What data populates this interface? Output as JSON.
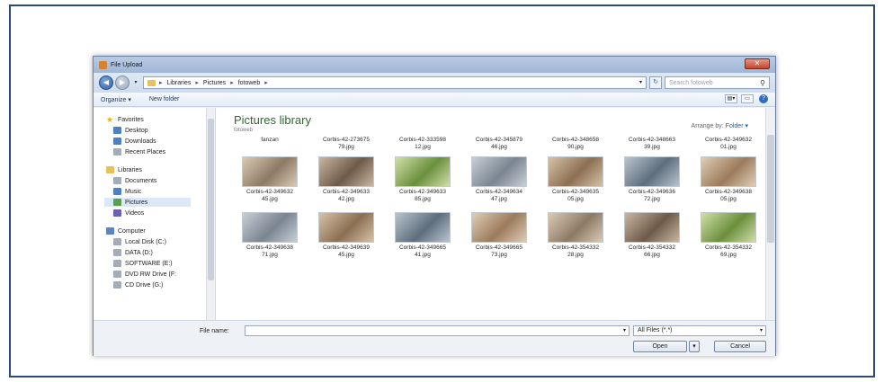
{
  "dialog": {
    "title": "File Upload",
    "close_label": "✕"
  },
  "address": {
    "crumbs": [
      "Libraries",
      "Pictures",
      "fotoweb"
    ],
    "search_placeholder": "Search fotoweb"
  },
  "toolbar": {
    "organize": "Organize ▾",
    "new_folder": "New folder"
  },
  "nav": {
    "favorites": {
      "label": "Favorites",
      "items": [
        "Desktop",
        "Downloads",
        "Recent Places"
      ]
    },
    "libraries": {
      "label": "Libraries",
      "items": [
        "Documents",
        "Music",
        "Pictures",
        "Videos"
      ],
      "selected": "Pictures"
    },
    "computer": {
      "label": "Computer",
      "items": [
        "Local Disk (C:)",
        "DATA (D:)",
        "SOFTWARE (E:)",
        "DVD RW Drive (F:",
        "CD Drive (G:)"
      ]
    }
  },
  "main": {
    "title": "Pictures library",
    "subtitle": "fotoweb",
    "arrange_label": "Arrange by:",
    "arrange_value": "Folder ▾",
    "rows": [
      {
        "labels_top": [
          "fanzan",
          "Corbis-42-273675\n79.jpg",
          "Corbis-42-333598\n12.jpg",
          "Corbis-42-345879\n46.jpg",
          "Corbis-42-348658\n90.jpg",
          "Corbis-42-348663\n39.jpg",
          "Corbis-42-349632\n01.jpg"
        ]
      },
      {
        "labels": [
          "Corbis-42-349632\n45.jpg",
          "Corbis-42-349633\n42.jpg",
          "Corbis-42-349633\n85.jpg",
          "Corbis-42-349634\n47.jpg",
          "Corbis-42-349635\n05.jpg",
          "Corbis-42-349636\n72.jpg",
          "Corbis-42-349638\n05.jpg"
        ]
      },
      {
        "labels": [
          "Corbis-42-349638\n71.jpg",
          "Corbis-42-349639\n45.jpg",
          "Corbis-42-349665\n41.jpg",
          "Corbis-42-349665\n73.jpg",
          "Corbis-42-354332\n28.jpg",
          "Corbis-42-354332\n66.jpg",
          "Corbis-42-354332\n69.jpg"
        ]
      }
    ]
  },
  "footer": {
    "file_name_label": "File name:",
    "file_name_value": "",
    "filter": "All Files (*.*)",
    "open": "Open",
    "cancel": "Cancel"
  }
}
